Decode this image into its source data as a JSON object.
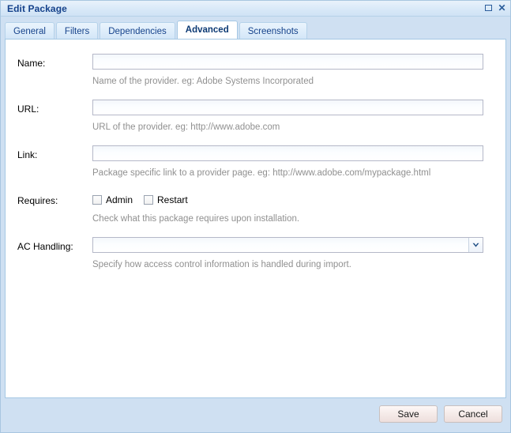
{
  "window": {
    "title": "Edit Package",
    "controls": [
      {
        "name": "restore-button",
        "glyph": ""
      },
      {
        "name": "close-button",
        "glyph": "✕"
      }
    ]
  },
  "tabs": [
    {
      "label": "General",
      "active": false
    },
    {
      "label": "Filters",
      "active": false
    },
    {
      "label": "Dependencies",
      "active": false
    },
    {
      "label": "Advanced",
      "active": true
    },
    {
      "label": "Screenshots",
      "active": false
    }
  ],
  "form": {
    "rows": [
      {
        "label": "Name:",
        "type": "text",
        "value": "",
        "placeholder": "",
        "hint": "Name of the provider. eg: Adobe Systems Incorporated"
      },
      {
        "label": "URL:",
        "type": "text",
        "value": "",
        "placeholder": "",
        "hint": "URL of the provider. eg: http://www.adobe.com"
      },
      {
        "label": "Link:",
        "type": "text",
        "value": "",
        "placeholder": "",
        "hint": "Package specific link to a provider page. eg: http://www.adobe.com/mypackage.html"
      },
      {
        "label": "Requires:",
        "type": "checkboxes",
        "hint": "Check what this package requires upon installation.",
        "checkboxes": [
          {
            "label": "Admin",
            "checked": false
          },
          {
            "label": "Restart",
            "checked": false
          }
        ]
      },
      {
        "label": "AC Handling:",
        "type": "select",
        "value": "",
        "hint": "Specify how access control information is handled during import."
      }
    ]
  },
  "footer": {
    "save_label": "Save",
    "cancel_label": "Cancel"
  },
  "colors": {
    "title_text": "#15428b",
    "panel_bg": "#ffffff",
    "chrome_bg": "#cfe0f2",
    "hint_text": "#909090",
    "border": "#a5c8e4"
  }
}
